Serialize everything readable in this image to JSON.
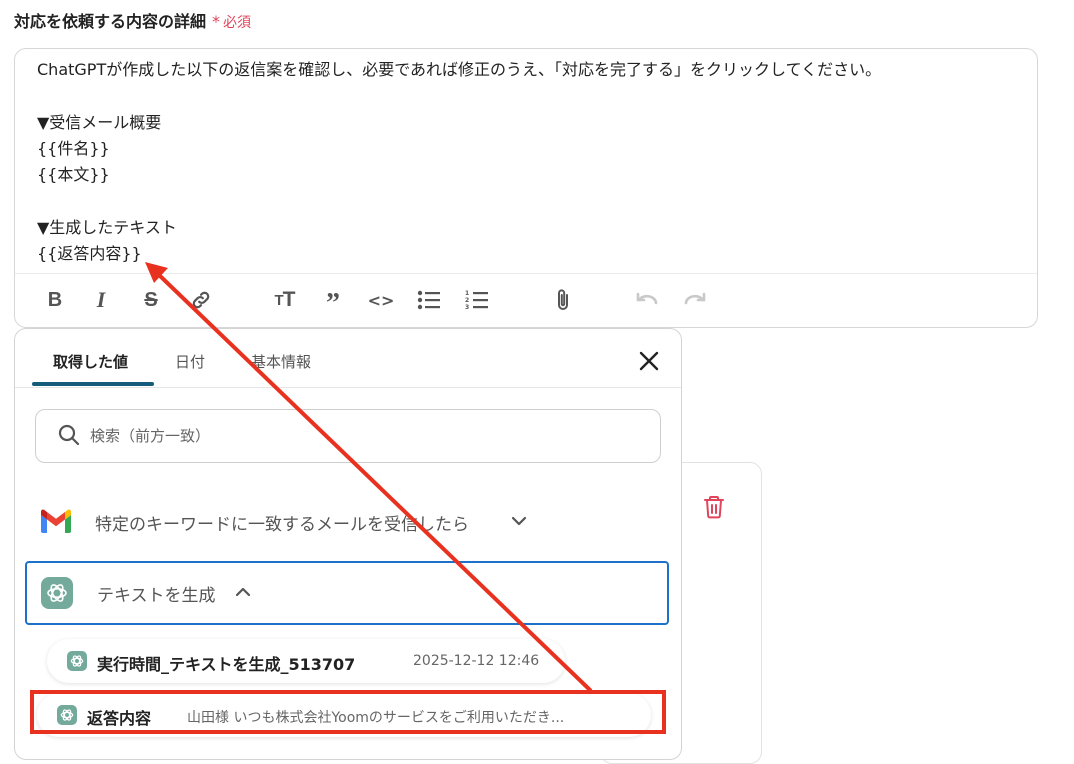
{
  "field": {
    "label": "対応を依頼する内容の詳細",
    "required_label": "必須",
    "required_mark": "*"
  },
  "editor": {
    "lines": [
      "ChatGPTが作成した以下の返信案を確認し、必要であれば修正のうえ、「対応を完了する」をクリックしてください。",
      "",
      "▼受信メール概要",
      "{{件名}}",
      "{{本文}}",
      "",
      "▼生成したテキスト",
      "{{返答内容}}"
    ],
    "toolbar": [
      "bold-icon",
      "italic-icon",
      "strikethrough-icon",
      "link-icon",
      "text-size-icon",
      "quote-icon",
      "code-icon",
      "bullet-list-icon",
      "numbered-list-icon",
      "attachment-icon",
      "undo-icon",
      "redo-icon"
    ]
  },
  "popup": {
    "tabs": [
      {
        "label": "取得した値"
      },
      {
        "label": "日付"
      },
      {
        "label": "基本情報"
      }
    ],
    "search_placeholder": "検索（前方一致）",
    "groups": [
      {
        "label": "特定のキーワードに一致するメールを受信したら",
        "icon": "gmail-icon"
      },
      {
        "label": "テキストを生成",
        "icon": "chatgpt-icon"
      }
    ],
    "items": [
      {
        "title": "実行時間_テキストを生成_513707",
        "value": "2025-12-12 12:46"
      },
      {
        "title": "返答内容",
        "value": "山田様 いつも株式会社Yoomのサービスをご利用いただき..."
      }
    ]
  },
  "colors": {
    "accent": "#145c7a",
    "required": "#e0455c",
    "selection": "#1d71c9",
    "annotation": "#e8321f"
  }
}
